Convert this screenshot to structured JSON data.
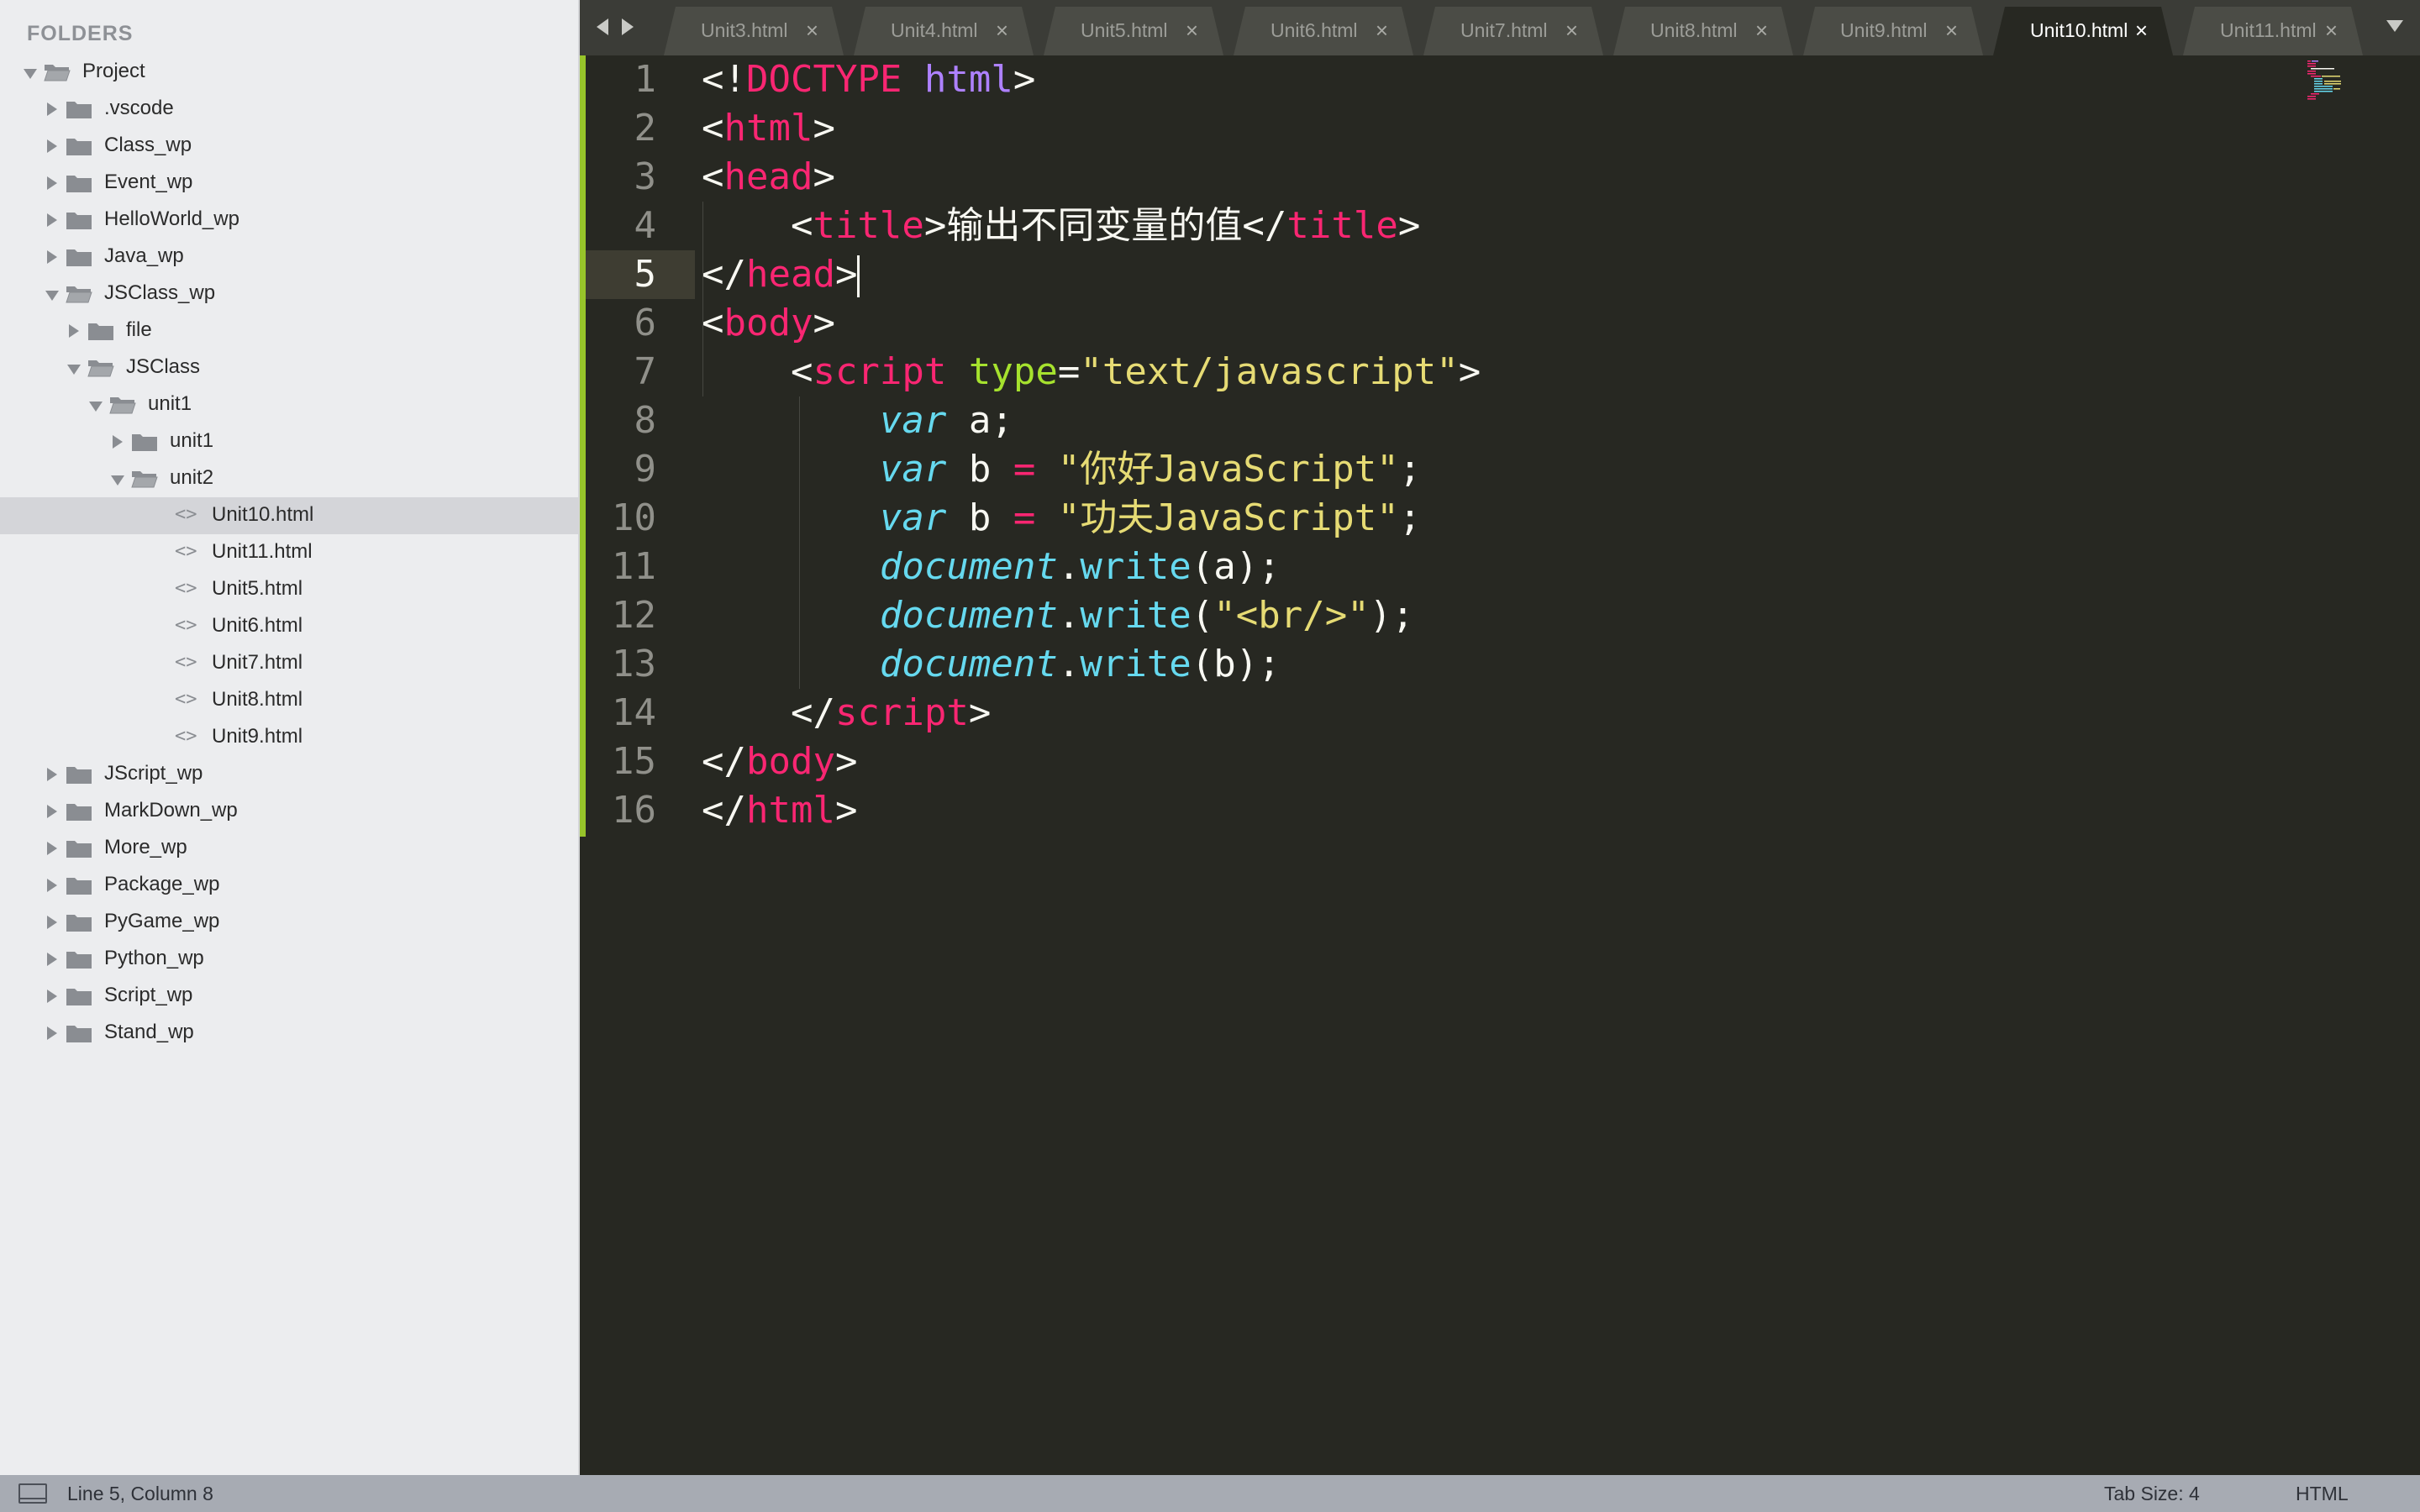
{
  "sidebar": {
    "header": "FOLDERS",
    "items": [
      {
        "label": "Project",
        "kind": "folder",
        "depth": 0,
        "expanded": true
      },
      {
        "label": ".vscode",
        "kind": "folder",
        "depth": 1,
        "expanded": false
      },
      {
        "label": "Class_wp",
        "kind": "folder",
        "depth": 1,
        "expanded": false
      },
      {
        "label": "Event_wp",
        "kind": "folder",
        "depth": 1,
        "expanded": false
      },
      {
        "label": "HelloWorld_wp",
        "kind": "folder",
        "depth": 1,
        "expanded": false
      },
      {
        "label": "Java_wp",
        "kind": "folder",
        "depth": 1,
        "expanded": false
      },
      {
        "label": "JSClass_wp",
        "kind": "folder",
        "depth": 1,
        "expanded": true
      },
      {
        "label": "file",
        "kind": "folder",
        "depth": 2,
        "expanded": false
      },
      {
        "label": "JSClass",
        "kind": "folder",
        "depth": 2,
        "expanded": true
      },
      {
        "label": "unit1",
        "kind": "folder",
        "depth": 3,
        "expanded": true
      },
      {
        "label": "unit1",
        "kind": "folder",
        "depth": 4,
        "expanded": false
      },
      {
        "label": "unit2",
        "kind": "folder",
        "depth": 4,
        "expanded": true
      },
      {
        "label": "Unit10.html",
        "kind": "file",
        "depth": 5,
        "selected": true
      },
      {
        "label": "Unit11.html",
        "kind": "file",
        "depth": 5
      },
      {
        "label": "Unit5.html",
        "kind": "file",
        "depth": 5
      },
      {
        "label": "Unit6.html",
        "kind": "file",
        "depth": 5
      },
      {
        "label": "Unit7.html",
        "kind": "file",
        "depth": 5
      },
      {
        "label": "Unit8.html",
        "kind": "file",
        "depth": 5
      },
      {
        "label": "Unit9.html",
        "kind": "file",
        "depth": 5
      },
      {
        "label": "JScript_wp",
        "kind": "folder",
        "depth": 1,
        "expanded": false
      },
      {
        "label": "MarkDown_wp",
        "kind": "folder",
        "depth": 1,
        "expanded": false
      },
      {
        "label": "More_wp",
        "kind": "folder",
        "depth": 1,
        "expanded": false
      },
      {
        "label": "Package_wp",
        "kind": "folder",
        "depth": 1,
        "expanded": false
      },
      {
        "label": "PyGame_wp",
        "kind": "folder",
        "depth": 1,
        "expanded": false
      },
      {
        "label": "Python_wp",
        "kind": "folder",
        "depth": 1,
        "expanded": false
      },
      {
        "label": "Script_wp",
        "kind": "folder",
        "depth": 1,
        "expanded": false
      },
      {
        "label": "Stand_wp",
        "kind": "folder",
        "depth": 1,
        "expanded": false
      }
    ]
  },
  "tabs": [
    {
      "label": "Unit3.html",
      "active": false
    },
    {
      "label": "Unit4.html",
      "active": false
    },
    {
      "label": "Unit5.html",
      "active": false
    },
    {
      "label": "Unit6.html",
      "active": false
    },
    {
      "label": "Unit7.html",
      "active": false
    },
    {
      "label": "Unit8.html",
      "active": false
    },
    {
      "label": "Unit9.html",
      "active": false
    },
    {
      "label": "Unit10.html",
      "active": true
    },
    {
      "label": "Unit11.html",
      "active": false
    }
  ],
  "tab_close_glyph": "×",
  "editor": {
    "current_line": 5,
    "lines": [
      [
        [
          "<!",
          "p"
        ],
        [
          "DOCTYPE",
          "doctype"
        ],
        [
          " ",
          "p"
        ],
        [
          "html",
          "html"
        ],
        [
          ">",
          "p"
        ]
      ],
      [
        [
          "<",
          "p"
        ],
        [
          "html",
          "tag"
        ],
        [
          ">",
          "p"
        ]
      ],
      [
        [
          "<",
          "p"
        ],
        [
          "head",
          "tag"
        ],
        [
          ">",
          "p"
        ]
      ],
      [
        [
          "    <",
          "p"
        ],
        [
          "title",
          "tag"
        ],
        [
          ">输出不同变量的值</",
          "p"
        ],
        [
          "title",
          "tag"
        ],
        [
          ">",
          "p"
        ]
      ],
      [
        [
          "</",
          "p"
        ],
        [
          "head",
          "tag"
        ],
        [
          ">",
          "p"
        ]
      ],
      [
        [
          "<",
          "p"
        ],
        [
          "body",
          "tag"
        ],
        [
          ">",
          "p"
        ]
      ],
      [
        [
          "    <",
          "p"
        ],
        [
          "script",
          "tag"
        ],
        [
          " ",
          "p"
        ],
        [
          "type",
          "attr"
        ],
        [
          "=",
          "p"
        ],
        [
          "\"text/javascript\"",
          "str"
        ],
        [
          ">",
          "p"
        ]
      ],
      [
        [
          "        ",
          "p"
        ],
        [
          "var",
          "kw"
        ],
        [
          " a;",
          "p"
        ]
      ],
      [
        [
          "        ",
          "p"
        ],
        [
          "var",
          "kw"
        ],
        [
          " b ",
          "p"
        ],
        [
          "=",
          "op"
        ],
        [
          " ",
          "p"
        ],
        [
          "\"你好JavaScript\"",
          "str"
        ],
        [
          ";",
          "p"
        ]
      ],
      [
        [
          "        ",
          "p"
        ],
        [
          "var",
          "kw"
        ],
        [
          " b ",
          "p"
        ],
        [
          "=",
          "op"
        ],
        [
          " ",
          "p"
        ],
        [
          "\"功夫JavaScript\"",
          "str"
        ],
        [
          ";",
          "p"
        ]
      ],
      [
        [
          "        ",
          "p"
        ],
        [
          "document",
          "obj"
        ],
        [
          ".",
          "p"
        ],
        [
          "write",
          "fn"
        ],
        [
          "(a);",
          "p"
        ]
      ],
      [
        [
          "        ",
          "p"
        ],
        [
          "document",
          "obj"
        ],
        [
          ".",
          "p"
        ],
        [
          "write",
          "fn"
        ],
        [
          "(",
          "p"
        ],
        [
          "\"<br/>\"",
          "str"
        ],
        [
          ");",
          "p"
        ]
      ],
      [
        [
          "        ",
          "p"
        ],
        [
          "document",
          "obj"
        ],
        [
          ".",
          "p"
        ],
        [
          "write",
          "fn"
        ],
        [
          "(b);",
          "p"
        ]
      ],
      [
        [
          "    </",
          "p"
        ],
        [
          "script",
          "tag"
        ],
        [
          ">",
          "p"
        ]
      ],
      [
        [
          "</",
          "p"
        ],
        [
          "body",
          "tag"
        ],
        [
          ">",
          "p"
        ]
      ],
      [
        [
          "</",
          "p"
        ],
        [
          "html",
          "tag"
        ],
        [
          ">",
          "p"
        ]
      ]
    ]
  },
  "status": {
    "position": "Line 5, Column 8",
    "tab_size": "Tab Size: 4",
    "syntax": "HTML"
  },
  "colors": {
    "editor_bg": "#272822",
    "tag": "#f92672",
    "attr": "#a6e22e",
    "string": "#e6db74",
    "keyword": "#66d9ef",
    "modified_marker": "#97c42a"
  }
}
